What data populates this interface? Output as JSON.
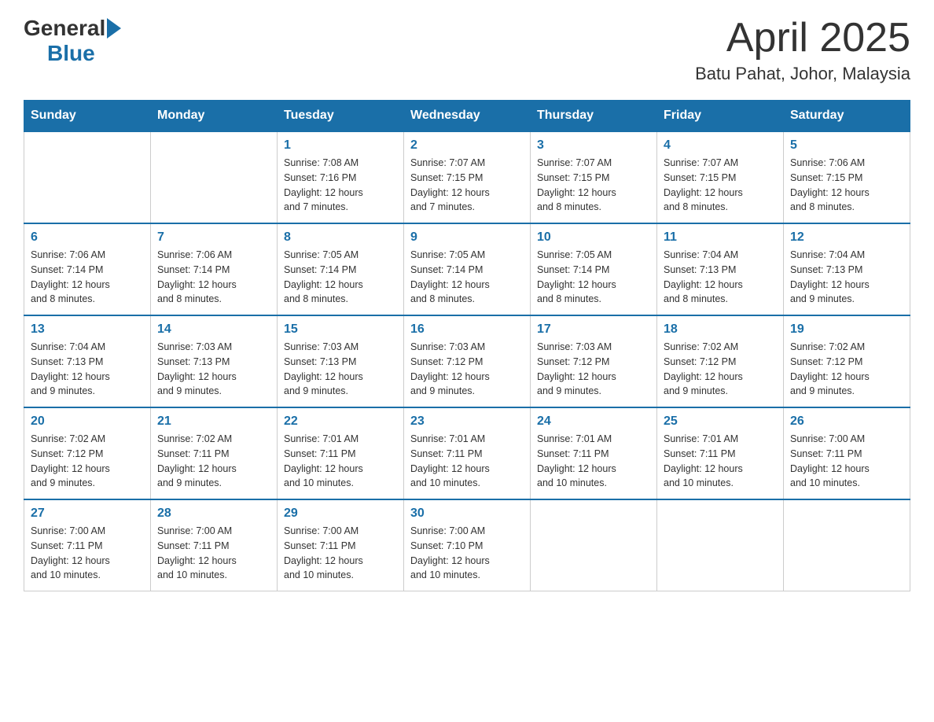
{
  "header": {
    "logo_general": "General",
    "logo_blue": "Blue",
    "title": "April 2025",
    "subtitle": "Batu Pahat, Johor, Malaysia"
  },
  "days_of_week": [
    "Sunday",
    "Monday",
    "Tuesday",
    "Wednesday",
    "Thursday",
    "Friday",
    "Saturday"
  ],
  "weeks": [
    [
      {
        "day": "",
        "info": ""
      },
      {
        "day": "",
        "info": ""
      },
      {
        "day": "1",
        "info": "Sunrise: 7:08 AM\nSunset: 7:16 PM\nDaylight: 12 hours\nand 7 minutes."
      },
      {
        "day": "2",
        "info": "Sunrise: 7:07 AM\nSunset: 7:15 PM\nDaylight: 12 hours\nand 7 minutes."
      },
      {
        "day": "3",
        "info": "Sunrise: 7:07 AM\nSunset: 7:15 PM\nDaylight: 12 hours\nand 8 minutes."
      },
      {
        "day": "4",
        "info": "Sunrise: 7:07 AM\nSunset: 7:15 PM\nDaylight: 12 hours\nand 8 minutes."
      },
      {
        "day": "5",
        "info": "Sunrise: 7:06 AM\nSunset: 7:15 PM\nDaylight: 12 hours\nand 8 minutes."
      }
    ],
    [
      {
        "day": "6",
        "info": "Sunrise: 7:06 AM\nSunset: 7:14 PM\nDaylight: 12 hours\nand 8 minutes."
      },
      {
        "day": "7",
        "info": "Sunrise: 7:06 AM\nSunset: 7:14 PM\nDaylight: 12 hours\nand 8 minutes."
      },
      {
        "day": "8",
        "info": "Sunrise: 7:05 AM\nSunset: 7:14 PM\nDaylight: 12 hours\nand 8 minutes."
      },
      {
        "day": "9",
        "info": "Sunrise: 7:05 AM\nSunset: 7:14 PM\nDaylight: 12 hours\nand 8 minutes."
      },
      {
        "day": "10",
        "info": "Sunrise: 7:05 AM\nSunset: 7:14 PM\nDaylight: 12 hours\nand 8 minutes."
      },
      {
        "day": "11",
        "info": "Sunrise: 7:04 AM\nSunset: 7:13 PM\nDaylight: 12 hours\nand 8 minutes."
      },
      {
        "day": "12",
        "info": "Sunrise: 7:04 AM\nSunset: 7:13 PM\nDaylight: 12 hours\nand 9 minutes."
      }
    ],
    [
      {
        "day": "13",
        "info": "Sunrise: 7:04 AM\nSunset: 7:13 PM\nDaylight: 12 hours\nand 9 minutes."
      },
      {
        "day": "14",
        "info": "Sunrise: 7:03 AM\nSunset: 7:13 PM\nDaylight: 12 hours\nand 9 minutes."
      },
      {
        "day": "15",
        "info": "Sunrise: 7:03 AM\nSunset: 7:13 PM\nDaylight: 12 hours\nand 9 minutes."
      },
      {
        "day": "16",
        "info": "Sunrise: 7:03 AM\nSunset: 7:12 PM\nDaylight: 12 hours\nand 9 minutes."
      },
      {
        "day": "17",
        "info": "Sunrise: 7:03 AM\nSunset: 7:12 PM\nDaylight: 12 hours\nand 9 minutes."
      },
      {
        "day": "18",
        "info": "Sunrise: 7:02 AM\nSunset: 7:12 PM\nDaylight: 12 hours\nand 9 minutes."
      },
      {
        "day": "19",
        "info": "Sunrise: 7:02 AM\nSunset: 7:12 PM\nDaylight: 12 hours\nand 9 minutes."
      }
    ],
    [
      {
        "day": "20",
        "info": "Sunrise: 7:02 AM\nSunset: 7:12 PM\nDaylight: 12 hours\nand 9 minutes."
      },
      {
        "day": "21",
        "info": "Sunrise: 7:02 AM\nSunset: 7:11 PM\nDaylight: 12 hours\nand 9 minutes."
      },
      {
        "day": "22",
        "info": "Sunrise: 7:01 AM\nSunset: 7:11 PM\nDaylight: 12 hours\nand 10 minutes."
      },
      {
        "day": "23",
        "info": "Sunrise: 7:01 AM\nSunset: 7:11 PM\nDaylight: 12 hours\nand 10 minutes."
      },
      {
        "day": "24",
        "info": "Sunrise: 7:01 AM\nSunset: 7:11 PM\nDaylight: 12 hours\nand 10 minutes."
      },
      {
        "day": "25",
        "info": "Sunrise: 7:01 AM\nSunset: 7:11 PM\nDaylight: 12 hours\nand 10 minutes."
      },
      {
        "day": "26",
        "info": "Sunrise: 7:00 AM\nSunset: 7:11 PM\nDaylight: 12 hours\nand 10 minutes."
      }
    ],
    [
      {
        "day": "27",
        "info": "Sunrise: 7:00 AM\nSunset: 7:11 PM\nDaylight: 12 hours\nand 10 minutes."
      },
      {
        "day": "28",
        "info": "Sunrise: 7:00 AM\nSunset: 7:11 PM\nDaylight: 12 hours\nand 10 minutes."
      },
      {
        "day": "29",
        "info": "Sunrise: 7:00 AM\nSunset: 7:11 PM\nDaylight: 12 hours\nand 10 minutes."
      },
      {
        "day": "30",
        "info": "Sunrise: 7:00 AM\nSunset: 7:10 PM\nDaylight: 12 hours\nand 10 minutes."
      },
      {
        "day": "",
        "info": ""
      },
      {
        "day": "",
        "info": ""
      },
      {
        "day": "",
        "info": ""
      }
    ]
  ]
}
